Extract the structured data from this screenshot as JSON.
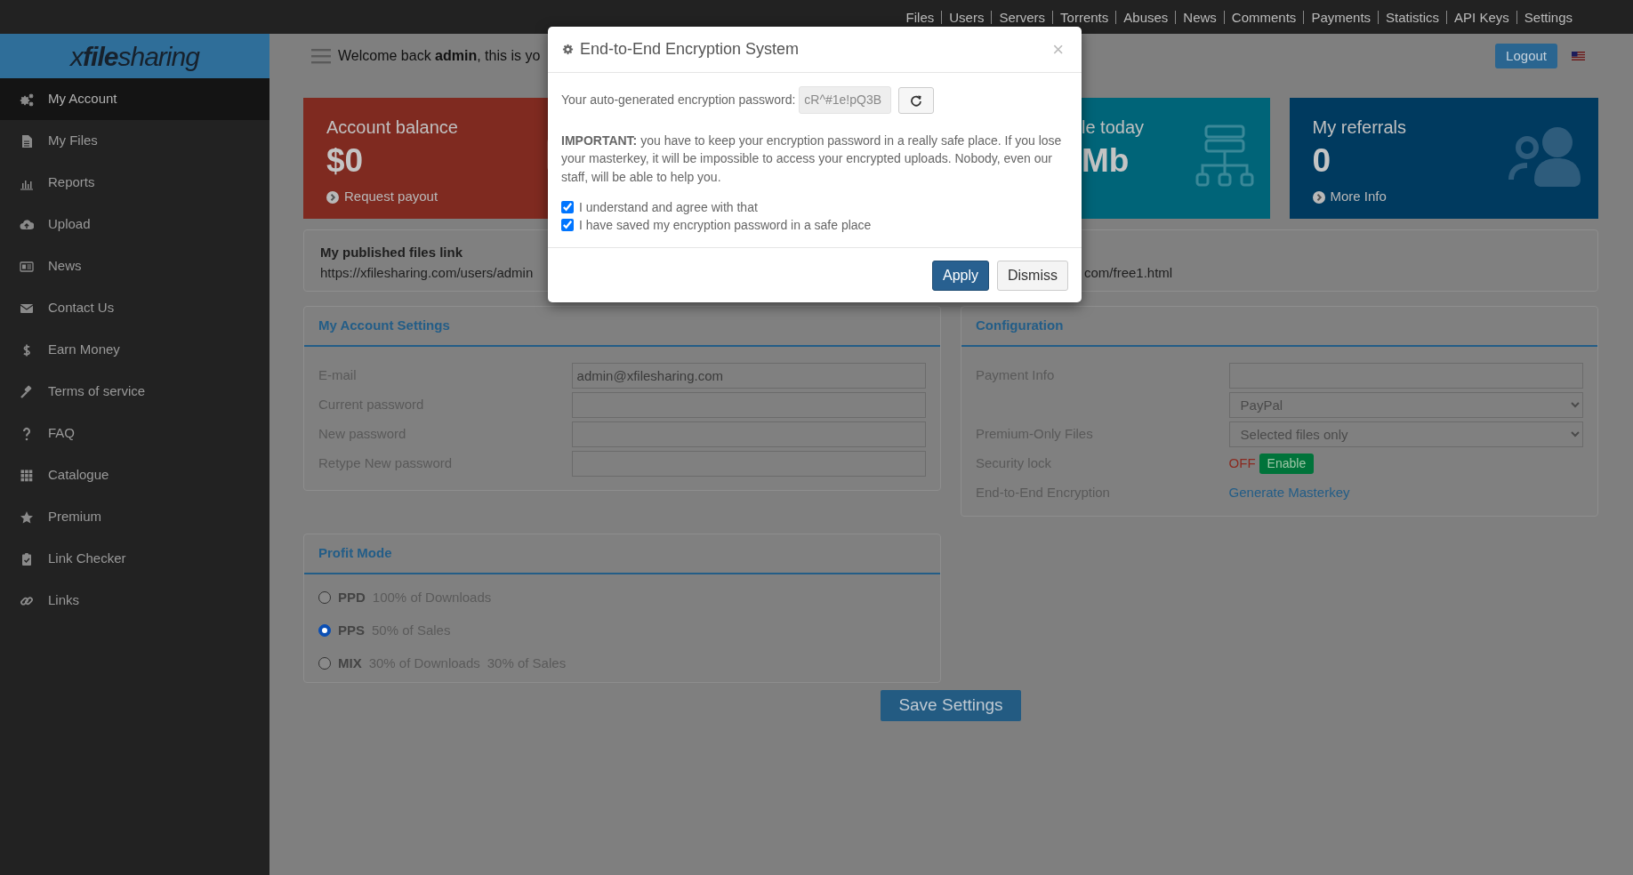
{
  "top_nav": [
    {
      "label": "Files"
    },
    {
      "label": "Users"
    },
    {
      "label": "Servers"
    },
    {
      "label": "Torrents"
    },
    {
      "label": "Abuses"
    },
    {
      "label": "News"
    },
    {
      "label": "Comments"
    },
    {
      "label": "Payments"
    },
    {
      "label": "Statistics"
    },
    {
      "label": "API Keys"
    },
    {
      "label": "Settings"
    }
  ],
  "logo": "x**file**sharing",
  "header": {
    "welcome": "Welcome back **admin**, this is yo",
    "logout": "Logout"
  },
  "sidebar": {
    "items": [
      {
        "label": "My Account",
        "selected": true
      },
      {
        "label": "My Files",
        "selected": false
      },
      {
        "label": "Reports",
        "selected": false
      },
      {
        "label": "Upload",
        "selected": false
      },
      {
        "label": "News",
        "selected": false
      },
      {
        "label": "Contact Us",
        "selected": false
      },
      {
        "label": "Earn Money",
        "selected": false
      },
      {
        "label": "Terms of service",
        "selected": false
      },
      {
        "label": "FAQ",
        "selected": false
      },
      {
        "label": "Catalogue",
        "selected": false
      },
      {
        "label": "Premium",
        "selected": false
      },
      {
        "label": "Link Checker",
        "selected": false
      },
      {
        "label": "Links",
        "selected": false
      }
    ]
  },
  "cards": [
    {
      "kind": "full",
      "title": "Account balance",
      "value": "$0",
      "link": "Request payout",
      "color": "#7f2a20"
    },
    {
      "kind": "partial",
      "title": "le today",
      "value": "Mb",
      "color": "#006478"
    },
    {
      "kind": "full",
      "title": "My referrals",
      "value": "0",
      "link": "More Info",
      "color": "#003a5f"
    }
  ],
  "published": {
    "title": "My published files link",
    "url": "https://xfilesharing.com/users/admin",
    "partial_link": "com/free1.html"
  },
  "account_settings": {
    "title": "My Account Settings",
    "fields": [
      {
        "label": "E-mail",
        "value": "admin@xfilesharing.com"
      },
      {
        "label": "Current password"
      },
      {
        "label": "New password"
      },
      {
        "label": "Retype New password"
      }
    ]
  },
  "configuration": {
    "title": "Configuration",
    "rows": [
      {
        "kind": "input",
        "label": "Payment Info"
      },
      {
        "kind": "select",
        "value": "PayPal"
      },
      {
        "kind": "select",
        "label": "Premium-Only Files",
        "value": "Selected files only"
      },
      {
        "kind": "toggle",
        "label": "Security lock",
        "status": "OFF",
        "on": false,
        "action": "Enable"
      },
      {
        "kind": "link",
        "label": "End-to-End Encryption",
        "value": "Generate Masterkey"
      }
    ]
  },
  "profit_mode": {
    "title": "Profit Mode",
    "options": [
      {
        "code": "PPD",
        "details": [
          "100% of Downloads"
        ],
        "selected": false
      },
      {
        "code": "PPS",
        "details": [
          "50% of Sales"
        ],
        "selected": true
      },
      {
        "code": "MIX",
        "details": [
          "30% of Downloads",
          "30% of Sales"
        ],
        "selected": false
      }
    ]
  },
  "save_button": "Save Settings",
  "modal": {
    "title": "End-to-End Encryption System",
    "close": "×",
    "password_label": "Your auto-generated encryption password:",
    "password": "cR^#1e!pQ3B",
    "notice": "**IMPORTANT:** you have to keep your encryption password in a really safe place. If you lose your masterkey, it will be impossible to access your encrypted uploads. Nobody, even our staff, will be able to help you.",
    "checkboxes": [
      {
        "label": "I understand and agree with that",
        "checked": true
      },
      {
        "label": "I have saved my encryption password in a safe place",
        "checked": true
      }
    ],
    "buttons": [
      {
        "kind": "primary",
        "label": "Apply"
      },
      {
        "kind": "secondary",
        "label": "Dismiss"
      }
    ]
  }
}
